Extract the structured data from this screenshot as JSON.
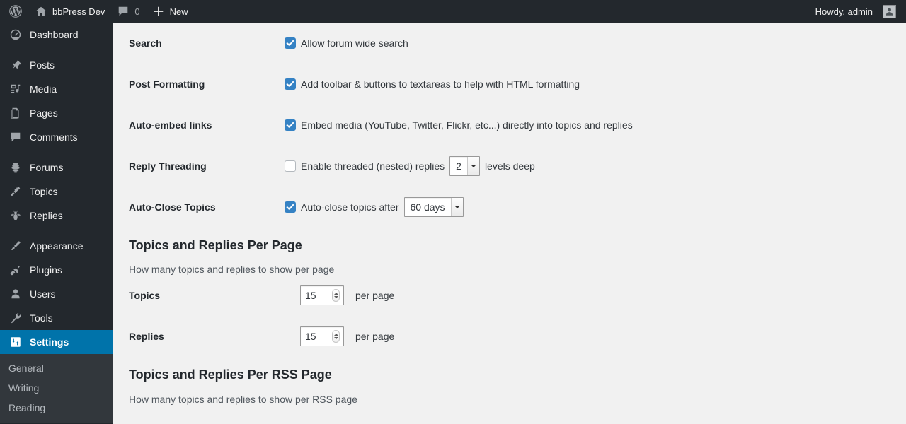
{
  "adminbar": {
    "site_icon": "wordpress-logo-icon",
    "home_icon": "home-icon",
    "site_name": "bbPress Dev",
    "comments_icon": "comment-bubble-icon",
    "comments_count": "0",
    "new_icon": "plus-icon",
    "new_label": "New",
    "howdy": "Howdy, admin",
    "avatar_icon": "user-avatar-icon"
  },
  "sidebar": {
    "items": [
      {
        "label": "Dashboard",
        "icon": "dashboard-gauge-icon",
        "current": false,
        "sep_after": true
      },
      {
        "label": "Posts",
        "icon": "pin-icon",
        "current": false,
        "sep_after": false
      },
      {
        "label": "Media",
        "icon": "media-music-icon",
        "current": false,
        "sep_after": false
      },
      {
        "label": "Pages",
        "icon": "pages-icon",
        "current": false,
        "sep_after": false
      },
      {
        "label": "Comments",
        "icon": "comment-bubble-icon",
        "current": false,
        "sep_after": true
      },
      {
        "label": "Forums",
        "icon": "beehive-icon",
        "current": false,
        "sep_after": false
      },
      {
        "label": "Topics",
        "icon": "flying-bee-icon",
        "current": false,
        "sep_after": false
      },
      {
        "label": "Replies",
        "icon": "bee-icon",
        "current": false,
        "sep_after": true
      },
      {
        "label": "Appearance",
        "icon": "paintbrush-icon",
        "current": false,
        "sep_after": false
      },
      {
        "label": "Plugins",
        "icon": "plug-icon",
        "current": false,
        "sep_after": false
      },
      {
        "label": "Users",
        "icon": "user-icon",
        "current": false,
        "sep_after": false
      },
      {
        "label": "Tools",
        "icon": "wrench-icon",
        "current": false,
        "sep_after": false
      },
      {
        "label": "Settings",
        "icon": "settings-sliders-icon",
        "current": true,
        "sep_after": false
      }
    ],
    "submenu": [
      {
        "label": "General"
      },
      {
        "label": "Writing"
      },
      {
        "label": "Reading"
      }
    ]
  },
  "colors": {
    "adminbar_bg": "#23282d",
    "sidebar_bg": "#23282d",
    "submenu_bg": "#32373c",
    "current_accent": "#0073aa",
    "checkbox_checked": "#3582c4",
    "content_bg": "#f1f1f1"
  },
  "settings": {
    "rows": [
      {
        "label": "Search",
        "checkbox_checked": true,
        "text": "Allow forum wide search"
      },
      {
        "label": "Post Formatting",
        "checkbox_checked": true,
        "text": "Add toolbar & buttons to textareas to help with HTML formatting"
      },
      {
        "label": "Auto-embed links",
        "checkbox_checked": true,
        "text": "Embed media (YouTube, Twitter, Flickr, etc...) directly into topics and replies"
      },
      {
        "label": "Reply Threading",
        "checkbox_checked": false,
        "text": "Enable threaded (nested) replies",
        "select_value": "2",
        "text_after": "levels deep"
      },
      {
        "label": "Auto-Close Topics",
        "checkbox_checked": true,
        "text": "Auto-close topics after",
        "select_value": "60 days"
      }
    ]
  },
  "per_page_section": {
    "heading": "Topics and Replies Per Page",
    "description": "How many topics and replies to show per page",
    "rows": [
      {
        "label": "Topics",
        "value": "15",
        "suffix": "per page"
      },
      {
        "label": "Replies",
        "value": "15",
        "suffix": "per page"
      }
    ]
  },
  "rss_section": {
    "heading": "Topics and Replies Per RSS Page",
    "description": "How many topics and replies to show per RSS page"
  }
}
